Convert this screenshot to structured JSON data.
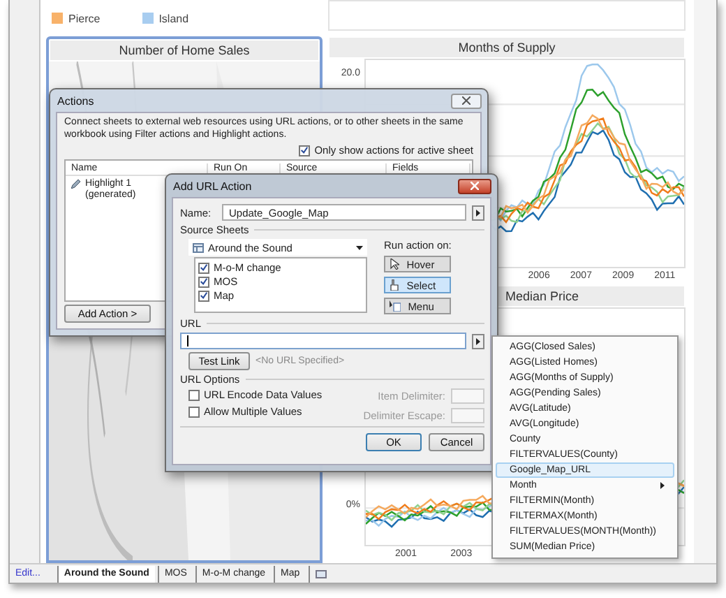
{
  "legend": [
    {
      "label": "Pierce",
      "color": "#f8b26a"
    },
    {
      "label": "Island",
      "color": "#a8cdf0"
    }
  ],
  "map_panel": {
    "title": "Number of Home Sales"
  },
  "supply_chart": {
    "title": "Months of Supply",
    "y_tick": "20.0",
    "x_ticks": [
      "2006",
      "2007",
      "2009",
      "2011"
    ]
  },
  "price_chart": {
    "title": "Median Price",
    "y_tick": "0%",
    "x_ticks": [
      "2001",
      "2003"
    ]
  },
  "sheet_bar": {
    "edit_link": "Edit...",
    "tabs": [
      {
        "label": "Around the Sound",
        "selected": true
      },
      {
        "label": "MOS",
        "selected": false
      },
      {
        "label": "M-o-M change",
        "selected": false
      },
      {
        "label": "Map",
        "selected": false
      }
    ]
  },
  "actions_dialog": {
    "title": "Actions",
    "description": "Connect sheets to external web resources using URL actions, or to other sheets in the same workbook using Filter actions and Highlight actions.",
    "active_only": {
      "label": "Only show actions for active sheet",
      "checked": true
    },
    "columns": [
      "Name",
      "Run On",
      "Source",
      "Fields"
    ],
    "rows": [
      {
        "name": "Highlight 1 (generated)"
      }
    ],
    "add_button": "Add Action >"
  },
  "url_dialog": {
    "title": "Add URL Action",
    "name_label": "Name:",
    "name_value": "Update_Google_Map",
    "source_label": "Source Sheets",
    "source_sheet": "Around the Sound",
    "sheets": [
      {
        "label": "M-o-M change",
        "checked": true
      },
      {
        "label": "MOS",
        "checked": true
      },
      {
        "label": "Map",
        "checked": true
      }
    ],
    "run_label": "Run action on:",
    "run_options": [
      {
        "label": "Hover",
        "kind": "hover",
        "selected": false
      },
      {
        "label": "Select",
        "kind": "select",
        "selected": true
      },
      {
        "label": "Menu",
        "kind": "menu",
        "selected": false
      }
    ],
    "url_label": "URL",
    "test_button": "Test Link",
    "url_status": "<No URL Specified>",
    "options_label": "URL Options",
    "options": [
      {
        "label": "URL Encode Data Values",
        "checked": false
      },
      {
        "label": "Allow Multiple Values",
        "checked": false
      }
    ],
    "delimiters": [
      "Item Delimiter:",
      "Delimiter Escape:"
    ],
    "ok": "OK",
    "cancel": "Cancel"
  },
  "field_menu": {
    "items": [
      {
        "label": "AGG(Closed Sales)",
        "highlighted": false,
        "submenu": false
      },
      {
        "label": "AGG(Listed Homes)",
        "highlighted": false,
        "submenu": false
      },
      {
        "label": "AGG(Months of Supply)",
        "highlighted": false,
        "submenu": false
      },
      {
        "label": "AGG(Pending Sales)",
        "highlighted": false,
        "submenu": false
      },
      {
        "label": "AVG(Latitude)",
        "highlighted": false,
        "submenu": false
      },
      {
        "label": "AVG(Longitude)",
        "highlighted": false,
        "submenu": false
      },
      {
        "label": "County",
        "highlighted": false,
        "submenu": false
      },
      {
        "label": "FILTERVALUES(County)",
        "highlighted": false,
        "submenu": false
      },
      {
        "label": "Google_Map_URL",
        "highlighted": true,
        "submenu": false
      },
      {
        "label": "Month",
        "highlighted": false,
        "submenu": true
      },
      {
        "label": "FILTERMIN(Month)",
        "highlighted": false,
        "submenu": false
      },
      {
        "label": "FILTERMAX(Month)",
        "highlighted": false,
        "submenu": false
      },
      {
        "label": "FILTERVALUES(MONTH(Month))",
        "highlighted": false,
        "submenu": false
      },
      {
        "label": "SUM(Median Price)",
        "highlighted": false,
        "submenu": false
      }
    ]
  }
}
